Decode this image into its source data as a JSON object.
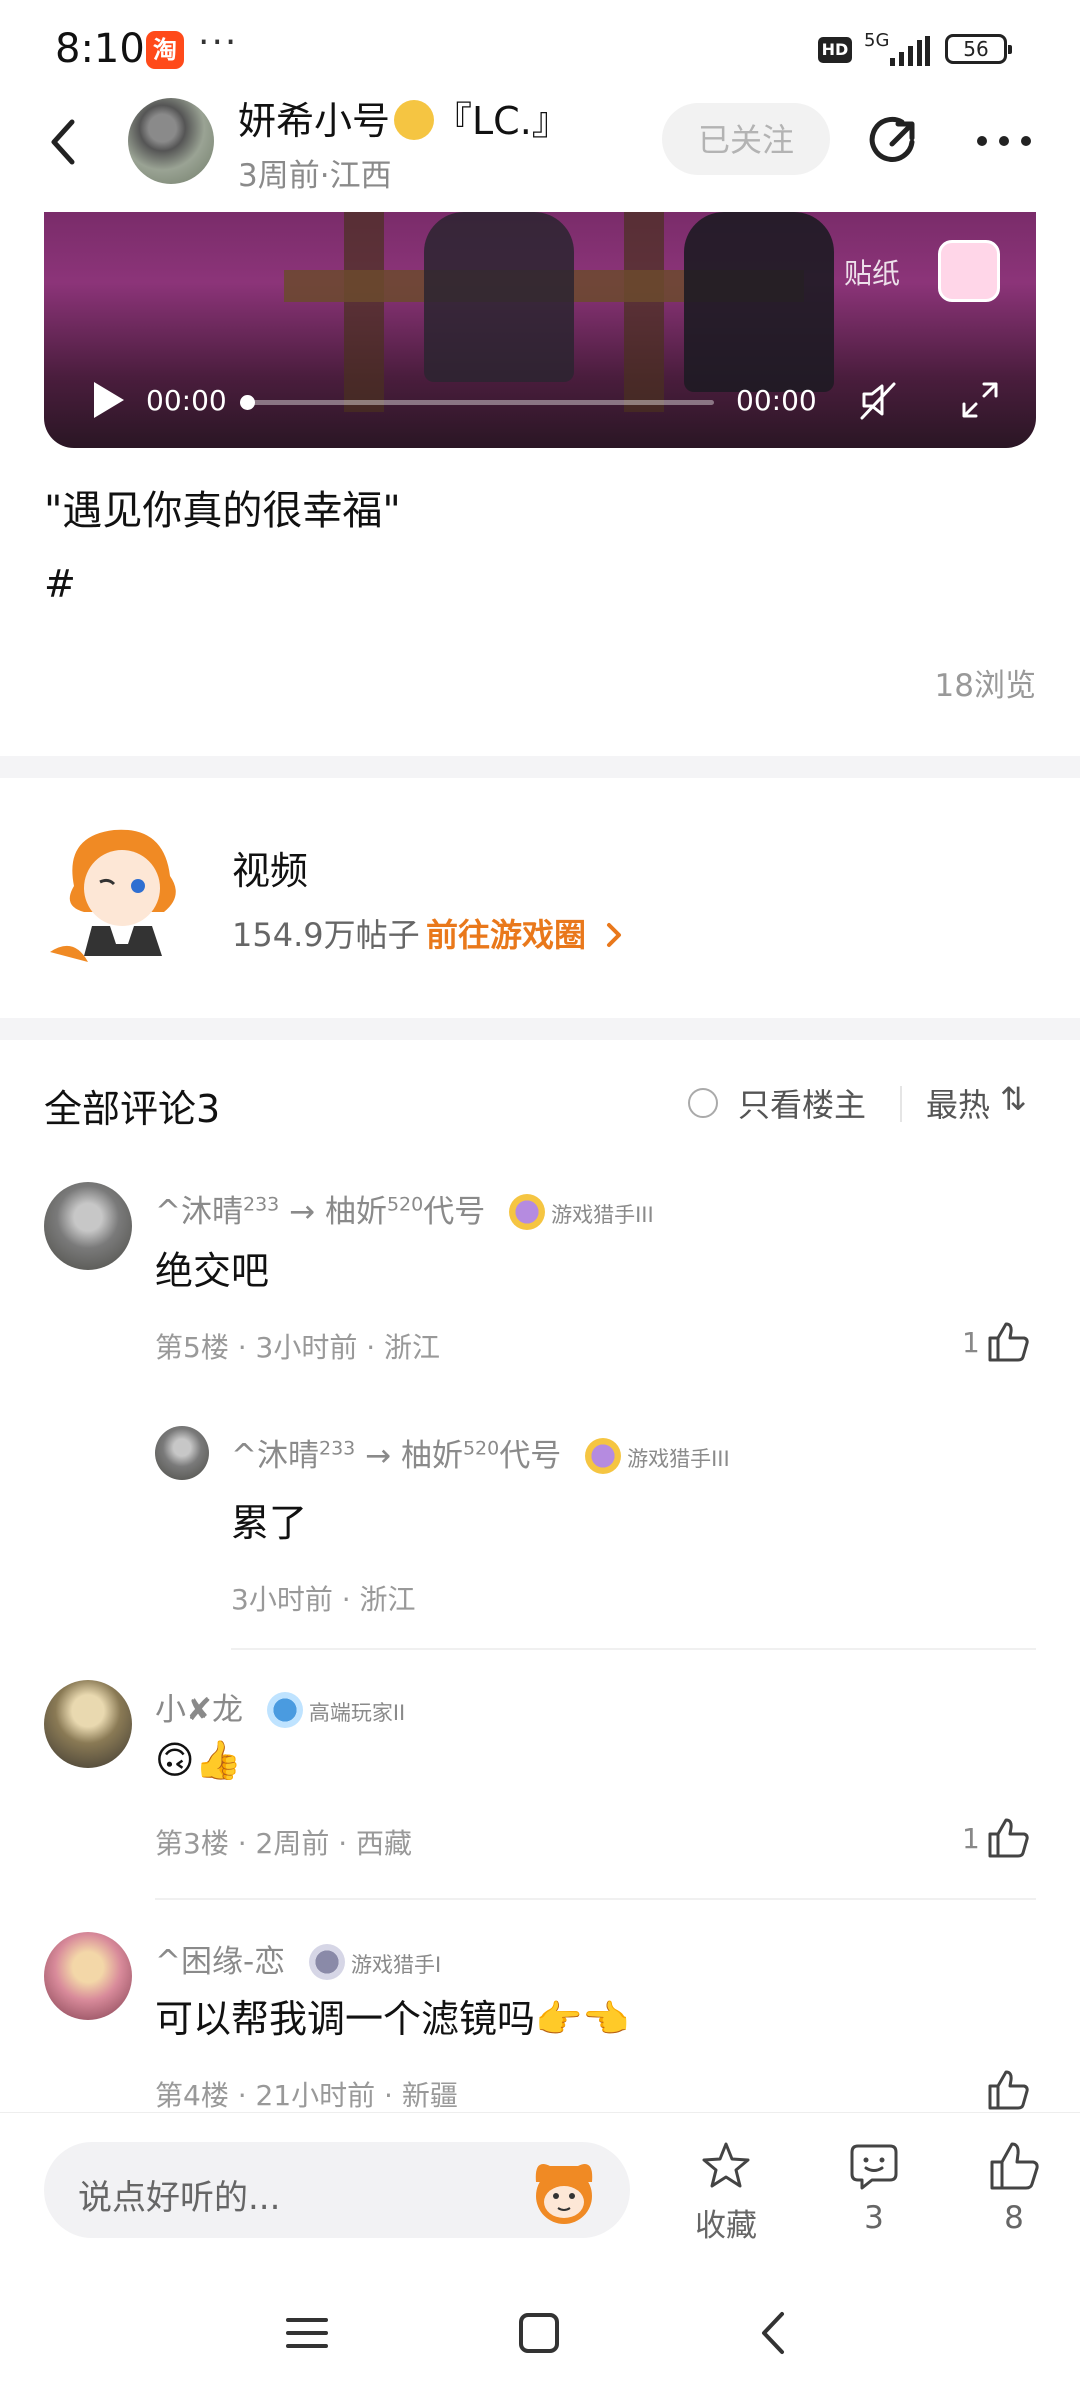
{
  "status_bar": {
    "time": "8:10",
    "app_badge": "淘",
    "more": "···",
    "hd": "HD",
    "network": "5G",
    "battery": "56"
  },
  "header": {
    "name": "妍希小号",
    "name_suffix": "『LC.』",
    "meta": "3周前·江西",
    "follow_label": "已关注"
  },
  "video": {
    "current_time": "00:00",
    "duration": "00:00",
    "sticker_label": "贴纸",
    "progress": 0
  },
  "post": {
    "title": "\"遇见你真的很幸福\"",
    "tag": "#",
    "views": "18浏览"
  },
  "circle": {
    "name": "视频",
    "posts": "154.9万帖子",
    "link": "前往游戏圈"
  },
  "comments_header": {
    "title": "全部评论3",
    "only_op": "只看楼主",
    "sort": "最热",
    "sort_icon": "⇅"
  },
  "comments": [
    {
      "name_a": "^沐晴",
      "sup_a": "233",
      "arrow": "→",
      "name_b": "柚妡",
      "sup_b": "520",
      "name_c": "代号",
      "badge_label": "游戏猎手III",
      "text": "绝交吧",
      "meta": "第5楼 · 3小时前 · 浙江",
      "likes": "1"
    },
    {
      "name_a": "^沐晴",
      "sup_a": "233",
      "arrow": "→",
      "name_b": "柚妡",
      "sup_b": "520",
      "name_c": "代号",
      "badge_label": "游戏猎手III",
      "text": "累了",
      "meta": "3小时前 · 浙江"
    },
    {
      "name": "小✘龙",
      "badge_label": "高端玩家II",
      "text": "🙃👍",
      "meta": "第3楼 · 2周前 · 西藏",
      "likes": "1"
    },
    {
      "name": "^困缘-恋",
      "badge_label": "游戏猎手I",
      "text": "可以帮我调一个滤镜吗👉👈",
      "meta": "第4楼 · 21小时前 · 新疆"
    }
  ],
  "bottom_bar": {
    "placeholder": "说点好听的...",
    "favorite": "收藏",
    "comments_count": "3",
    "likes_count": "8"
  },
  "icons": [
    "back-icon",
    "share-icon",
    "more-icon",
    "play-icon",
    "mute-icon",
    "fullscreen-icon",
    "chevron-right-icon",
    "like-icon",
    "star-icon",
    "comment-icon",
    "menu-icon",
    "home-icon",
    "back-nav-icon"
  ],
  "colors": {
    "accent": "#e9781b",
    "text": "#111111",
    "muted": "#8a8a8a"
  }
}
